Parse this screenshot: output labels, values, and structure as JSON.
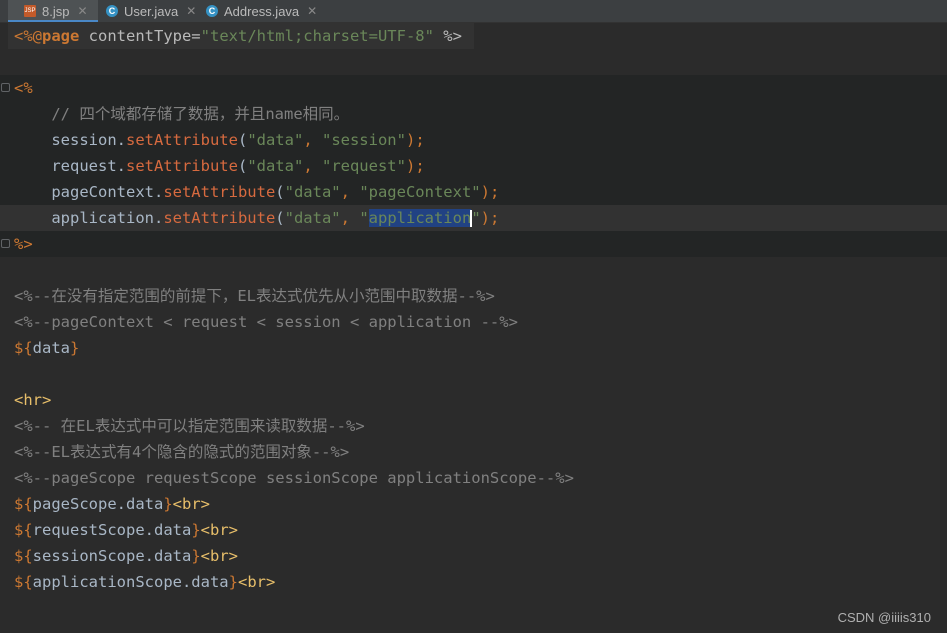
{
  "tabs": [
    {
      "label": "8.jsp",
      "icon": "jsp-file-icon",
      "active": true
    },
    {
      "label": "User.java",
      "icon": "java-class-icon",
      "active": false
    },
    {
      "label": "Address.java",
      "icon": "java-class-icon",
      "active": false
    }
  ],
  "code": {
    "l1_dir": "<%@",
    "l1_page": "page",
    "l1_attr": " contentType=",
    "l1_val": "\"text/html;charset=UTF-8\"",
    "l1_end": " %>",
    "l3_open": "<%",
    "l4_comment": "    // 四个域都存储了数据，并且name相同。",
    "l5_obj": "    session.",
    "l5_meth": "setAttribute",
    "l5_a": "(",
    "l5_s1": "\"data\"",
    "l5_c": ", ",
    "l5_s2": "\"session\"",
    "l5_e": ");",
    "l6_obj": "    request.",
    "l6_meth": "setAttribute",
    "l6_s1": "\"data\"",
    "l6_s2": "\"request\"",
    "l7_obj": "    pageContext.",
    "l7_meth": "setAttribute",
    "l7_s1": "\"data\"",
    "l7_s2": "\"pageContext\"",
    "l8_obj": "    application.",
    "l8_meth": "setAttribute",
    "l8_s1": "\"data\"",
    "l8_q": "\"",
    "l8_sel": "application",
    "l8_q2": "\"",
    "l9_close": "%>",
    "l11": "<%--在没有指定范围的前提下，EL表达式优先从小范围中取数据--%>",
    "l12": "<%--pageContext < request < session < application --%>",
    "l13_open": "${",
    "l13_id": "data",
    "l13_close": "}",
    "l15": "<hr>",
    "l16": "<%-- 在EL表达式中可以指定范围来读取数据--%>",
    "l17": "<%--EL表达式有4个隐含的隐式的范围对象--%>",
    "l18": "<%--pageScope requestScope sessionScope applicationScope--%>",
    "l19_id": "pageScope.data",
    "l20_id": "requestScope.data",
    "l21_id": "sessionScope.data",
    "l22_id": "applicationScope.data",
    "el_open": "${",
    "el_close": "}",
    "br": "<br>"
  },
  "watermark": "CSDN @iiiis310"
}
